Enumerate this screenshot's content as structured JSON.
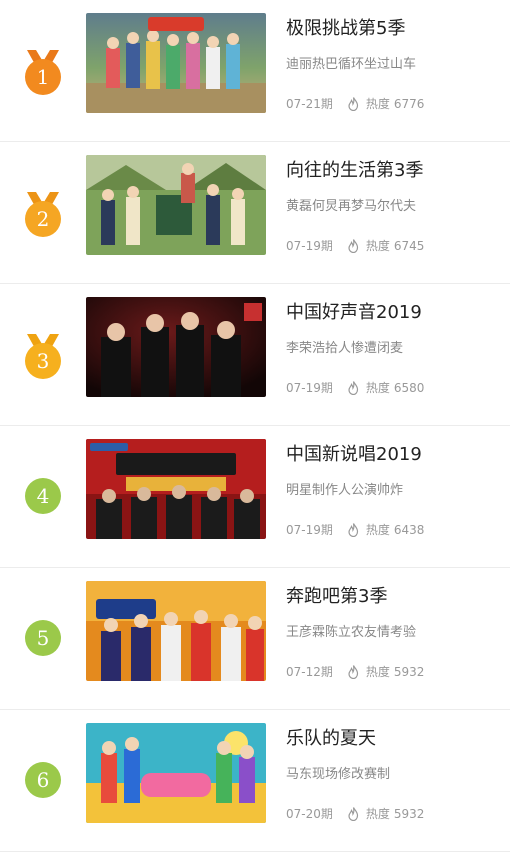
{
  "colors": {
    "gold": "#f28a1f",
    "silver": "#f5a623",
    "bronze": "#f6b01e",
    "plain": "#9bc94a",
    "title": "#222222",
    "desc": "#888888",
    "meta": "#999999"
  },
  "items": [
    {
      "rank": "1",
      "title": "极限挑战第5季",
      "desc": "迪丽热巴循环坐过山车",
      "date": "07-21期",
      "heat_label": "热度",
      "heat": "6776",
      "icon": "flame-icon"
    },
    {
      "rank": "2",
      "title": "向往的生活第3季",
      "desc": "黄磊何炅再梦马尔代夫",
      "date": "07-19期",
      "heat_label": "热度",
      "heat": "6745",
      "icon": "flame-icon"
    },
    {
      "rank": "3",
      "title": "中国好声音2019",
      "desc": "李荣浩拾人惨遭闭麦",
      "date": "07-19期",
      "heat_label": "热度",
      "heat": "6580",
      "icon": "flame-icon"
    },
    {
      "rank": "4",
      "title": "中国新说唱2019",
      "desc": "明星制作人公演帅炸",
      "date": "07-19期",
      "heat_label": "热度",
      "heat": "6438",
      "icon": "flame-icon"
    },
    {
      "rank": "5",
      "title": "奔跑吧第3季",
      "desc": "王彦霖陈立农友情考验",
      "date": "07-12期",
      "heat_label": "热度",
      "heat": "5932",
      "icon": "flame-icon"
    },
    {
      "rank": "6",
      "title": "乐队的夏天",
      "desc": "马东现场修改赛制",
      "date": "07-20期",
      "heat_label": "热度",
      "heat": "5932",
      "icon": "flame-icon"
    }
  ]
}
